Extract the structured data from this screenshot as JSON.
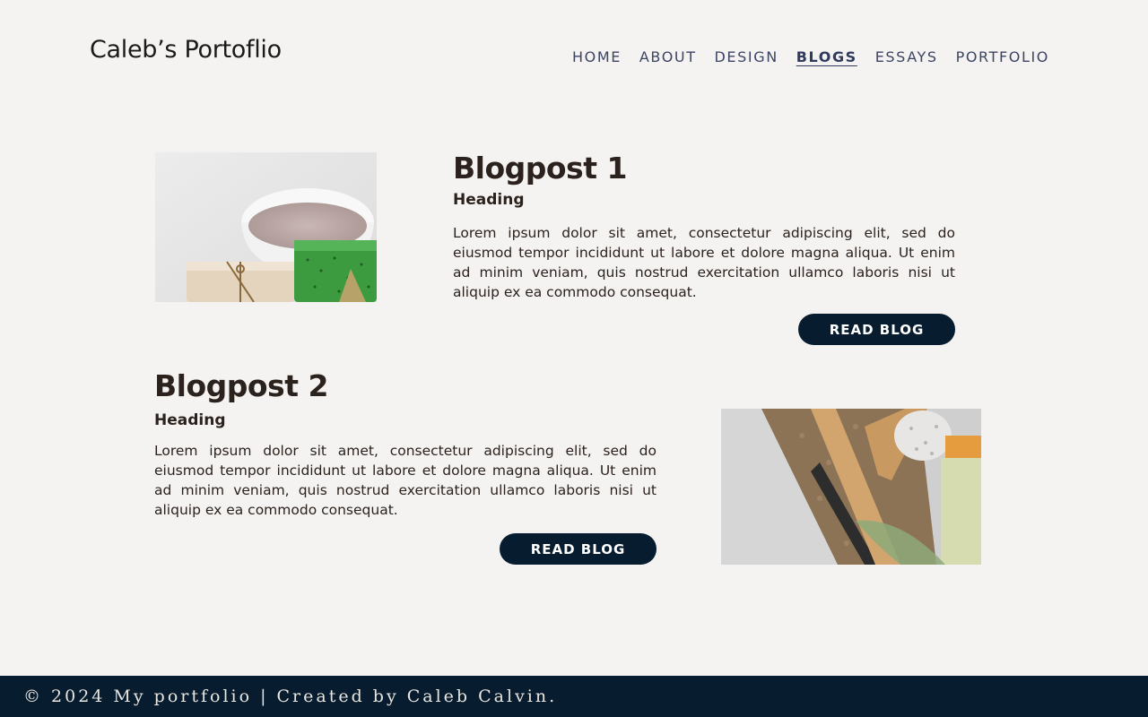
{
  "header": {
    "site_title": "Caleb’s Portoflio",
    "nav": [
      {
        "label": "HOME",
        "active": false
      },
      {
        "label": "ABOUT",
        "active": false
      },
      {
        "label": "DESIGN",
        "active": false
      },
      {
        "label": "BLOGS",
        "active": true
      },
      {
        "label": "ESSAYS",
        "active": false
      },
      {
        "label": "PORTFOLIO",
        "active": false
      }
    ]
  },
  "posts": [
    {
      "title": "Blogpost 1",
      "heading": "Heading",
      "body": "Lorem ipsum dolor sit amet, consectetur adipiscing elit, sed do eiusmod tempor incididunt ut labore et dolore magna aliqua. Ut enim ad minim veniam, quis nostrud exercitation ullamco laboris nisi ut aliquip ex ea commodo consequat.",
      "button": "READ BLOG",
      "image": "bath-salt-and-soap-bars-photo"
    },
    {
      "title": "Blogpost 2",
      "heading": "Heading",
      "body": "Lorem ipsum dolor sit amet, consectetur adipiscing elit, sed do eiusmod tempor incididunt ut labore et dolore magna aliqua. Ut enim ad minim veniam, quis nostrud exercitation ullamco laboris nisi ut aliquip ex ea commodo consequat.",
      "button": "READ BLOG",
      "image": "bath-brush-and-pumice-photo"
    }
  ],
  "footer": {
    "text": "© 2024 My portfolio | Created by Caleb Calvin."
  },
  "colors": {
    "background": "#f5f3f1",
    "navy": "#071c2f",
    "text": "#2b211d",
    "nav": "#3b4563"
  }
}
